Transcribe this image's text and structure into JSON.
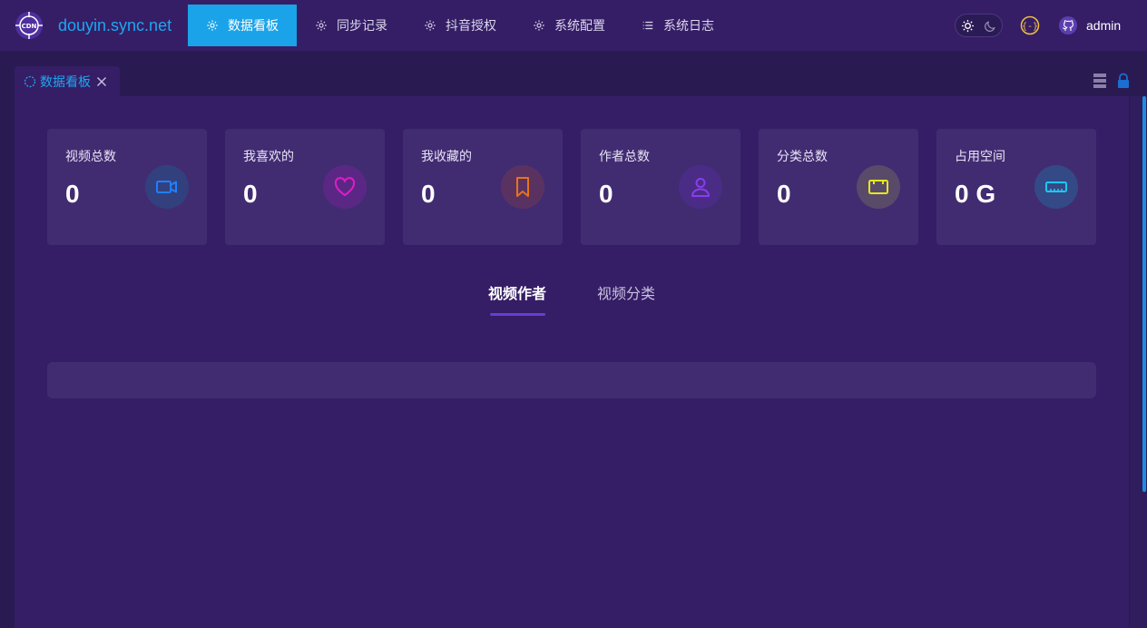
{
  "header": {
    "brand": "douyin.sync.net",
    "logo_icon": "crosshair-cdn-logo",
    "nav": [
      {
        "label": "数据看板",
        "icon": "gear-icon",
        "active": true
      },
      {
        "label": "同步记录",
        "icon": "gear-icon",
        "active": false
      },
      {
        "label": "抖音授权",
        "icon": "gear-icon",
        "active": false
      },
      {
        "label": "系统配置",
        "icon": "gear-icon",
        "active": false
      },
      {
        "label": "系统日志",
        "icon": "list-icon",
        "active": false
      }
    ],
    "user": "admin"
  },
  "tabs": [
    {
      "label": "数据看板"
    }
  ],
  "stats": [
    {
      "label": "视频总数",
      "value": "0",
      "icon": "video-camera-icon",
      "color": "#1e80ff"
    },
    {
      "label": "我喜欢的",
      "value": "0",
      "icon": "heart-icon",
      "color": "#e11bc8"
    },
    {
      "label": "我收藏的",
      "value": "0",
      "icon": "bookmark-icon",
      "color": "#e8731a"
    },
    {
      "label": "作者总数",
      "value": "0",
      "icon": "user-icon",
      "color": "#8a3cf0"
    },
    {
      "label": "分类总数",
      "value": "0",
      "icon": "box-icon",
      "color": "#e3e81a"
    },
    {
      "label": "占用空间",
      "value": "0 G",
      "icon": "ruler-icon",
      "color": "#1ec7f0"
    }
  ],
  "subtabs": [
    {
      "label": "视频作者",
      "active": true
    },
    {
      "label": "视频分类",
      "active": false
    }
  ],
  "colors": {
    "accent": "#1aa3e8",
    "background": "#2a1a52",
    "panel": "#351e66",
    "card": "#412c72"
  }
}
